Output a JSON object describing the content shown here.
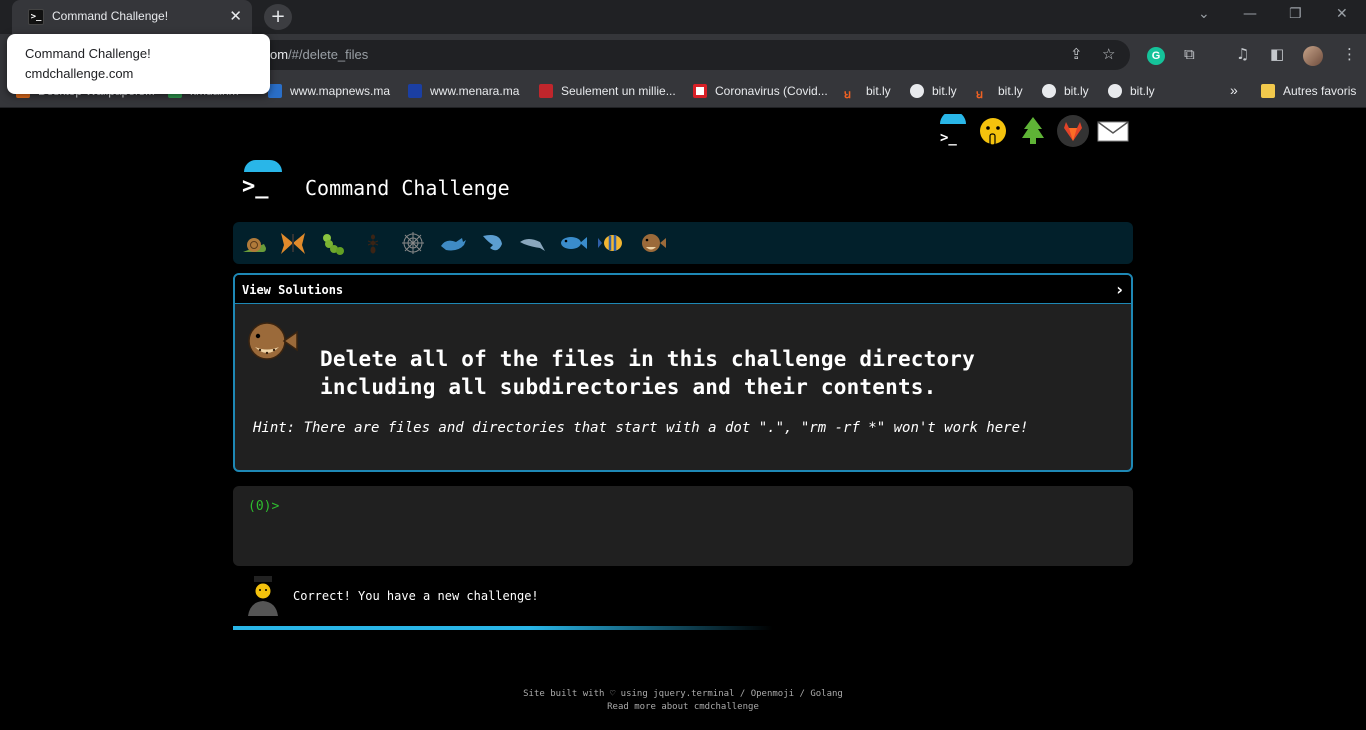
{
  "browser": {
    "tab_title": "Command Challenge!",
    "tab_close": "✕",
    "new_tab": "+",
    "url_host": "om",
    "url_path": "/#/delete_files",
    "popup": {
      "title": "Command Challenge!",
      "host": "cmdchallenge.com"
    },
    "window_controls": {
      "dropdown": "⌄",
      "minimize": "—",
      "restore": "❐",
      "close": "✕"
    },
    "bookmarks": [
      {
        "label": "Desktop Wallpapers...",
        "icon": "bookmark-orange-icon",
        "color": "#e86f1c"
      },
      {
        "label": "kmuainm",
        "icon": "bookmark-green-icon",
        "color": "#2e9b4f"
      },
      {
        "label": "www.mapnews.ma",
        "icon": "mapnews-icon",
        "color": "#2a6fc9"
      },
      {
        "label": "www.menara.ma",
        "icon": "menara-icon",
        "color": "#1b3fa3"
      },
      {
        "label": "Seulement un millie...",
        "icon": "news-icon",
        "color": "#c0262c"
      },
      {
        "label": "Coronavirus (Covid...",
        "icon": "c-logo-icon",
        "color": "#d82027"
      },
      {
        "label": "bit.ly",
        "icon": "bitly-icon",
        "color": "#ee6123"
      },
      {
        "label": "bit.ly",
        "icon": "globe-icon",
        "color": "#e8eaed"
      },
      {
        "label": "bit.ly",
        "icon": "bitly-icon",
        "color": "#ee6123"
      },
      {
        "label": "bit.ly",
        "icon": "globe-icon",
        "color": "#e8eaed"
      },
      {
        "label": "bit.ly",
        "icon": "globe-icon",
        "color": "#e8eaed"
      }
    ],
    "more_bookmarks": "»",
    "other_bookmarks": "Autres favoris"
  },
  "header": {
    "site_title": "Command Challenge",
    "top_icons": [
      "terminal-icon",
      "shushing-face-icon",
      "tree-icon",
      "gitlab-icon",
      "envelope-icon"
    ]
  },
  "animals": [
    "snail",
    "butterfly",
    "caterpillar",
    "ant",
    "spider-web",
    "whale",
    "shark",
    "dolphin",
    "fish",
    "tropical-fish",
    "pufferfish"
  ],
  "challenge": {
    "view_solutions": "View Solutions",
    "arrow": "›",
    "line1": "Delete all of the files in this challenge directory",
    "line2": "including all subdirectories and their contents.",
    "hint": "Hint: There are files and directories that start with a dot \".\", \"rm -rf *\" won't work here!"
  },
  "terminal": {
    "prompt": "(0)>"
  },
  "feedback": {
    "text": "Correct! You have a new challenge!"
  },
  "footer": {
    "line1": "Site built with ♡ using jquery.terminal / Openmoji / Golang",
    "line2": "Read more about cmdchallenge"
  },
  "colors": {
    "accent": "#29b6e8",
    "prompt_green": "#2ebd2e",
    "panel_border": "#1e88b5"
  }
}
